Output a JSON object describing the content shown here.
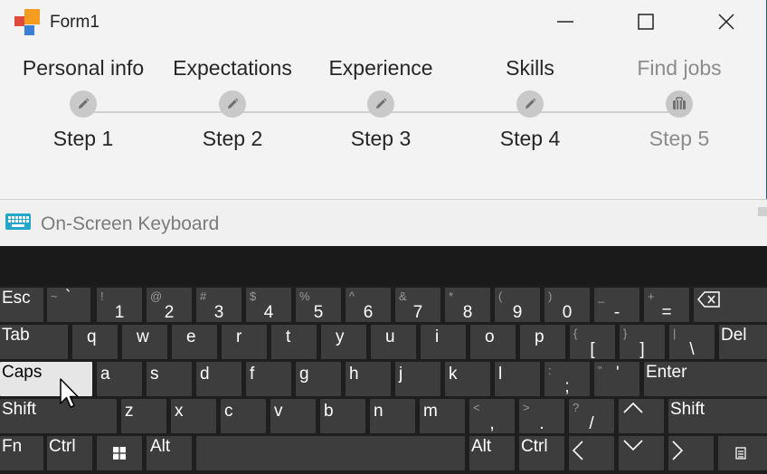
{
  "window": {
    "title": "Form1",
    "minimize_icon": "minimize-icon",
    "maximize_icon": "maximize-icon",
    "close_icon": "close-icon"
  },
  "stepper": {
    "steps": [
      {
        "caption": "Personal info",
        "label": "Step 1",
        "icon": "pencil-icon",
        "enabled": true
      },
      {
        "caption": "Expectations",
        "label": "Step 2",
        "icon": "pencil-icon",
        "enabled": true
      },
      {
        "caption": "Experience",
        "label": "Step 3",
        "icon": "pencil-icon",
        "enabled": true
      },
      {
        "caption": "Skills",
        "label": "Step 4",
        "icon": "pencil-icon",
        "enabled": true
      },
      {
        "caption": "Find jobs",
        "label": "Step 5",
        "icon": "briefcase-icon",
        "enabled": false
      }
    ]
  },
  "keyboard": {
    "title": "On-Screen Keyboard",
    "keys": {
      "esc": "Esc",
      "tab": "Tab",
      "caps": "Caps",
      "shift_left": "Shift",
      "shift_right": "Shift",
      "fn": "Fn",
      "ctrl_left": "Ctrl",
      "alt_left": "Alt",
      "alt_right": "Alt",
      "ctrl_right": "Ctrl",
      "del": "Del",
      "enter": "Enter",
      "n1": {
        "up": "!",
        "lo": "1"
      },
      "n2": {
        "up": "@",
        "lo": "2"
      },
      "n3": {
        "up": "#",
        "lo": "3"
      },
      "n4": {
        "up": "$",
        "lo": "4"
      },
      "n5": {
        "up": "%",
        "lo": "5"
      },
      "n6": {
        "up": "^",
        "lo": "6"
      },
      "n7": {
        "up": "&",
        "lo": "7"
      },
      "n8": {
        "up": "*",
        "lo": "8"
      },
      "n9": {
        "up": "(",
        "lo": "9"
      },
      "n0": {
        "up": ")",
        "lo": "0"
      },
      "minus": {
        "up": "_",
        "lo": "-"
      },
      "equals": {
        "up": "+",
        "lo": "="
      },
      "tilde": {
        "up": "~",
        "lo": "`"
      },
      "q": "q",
      "w": "w",
      "e": "e",
      "r": "r",
      "t": "t",
      "y": "y",
      "u": "u",
      "i": "i",
      "o": "o",
      "p": "p",
      "lbracket": {
        "up": "{",
        "lo": "["
      },
      "rbracket": {
        "up": "}",
        "lo": "]"
      },
      "backslash": {
        "up": "|",
        "lo": "\\"
      },
      "a": "a",
      "s": "s",
      "d": "d",
      "f": "f",
      "g": "g",
      "h": "h",
      "j": "j",
      "k": "k",
      "l": "l",
      "semicolon": {
        "up": ":",
        "lo": ";"
      },
      "quote": {
        "up": "\"",
        "lo": "'"
      },
      "z": "z",
      "x": "x",
      "c": "c",
      "v": "v",
      "b": "b",
      "n": "n",
      "m": "m",
      "comma": {
        "up": "<",
        "lo": ","
      },
      "period": {
        "up": ">",
        "lo": "."
      },
      "slash": {
        "up": "?",
        "lo": "/"
      }
    },
    "caps_active": true
  },
  "colors": {
    "accent_border": "#2b5797",
    "key_bg": "#3d3d3d",
    "key_active_bg": "#e6e6e6",
    "keyboard_bg": "#1e1e1e"
  }
}
